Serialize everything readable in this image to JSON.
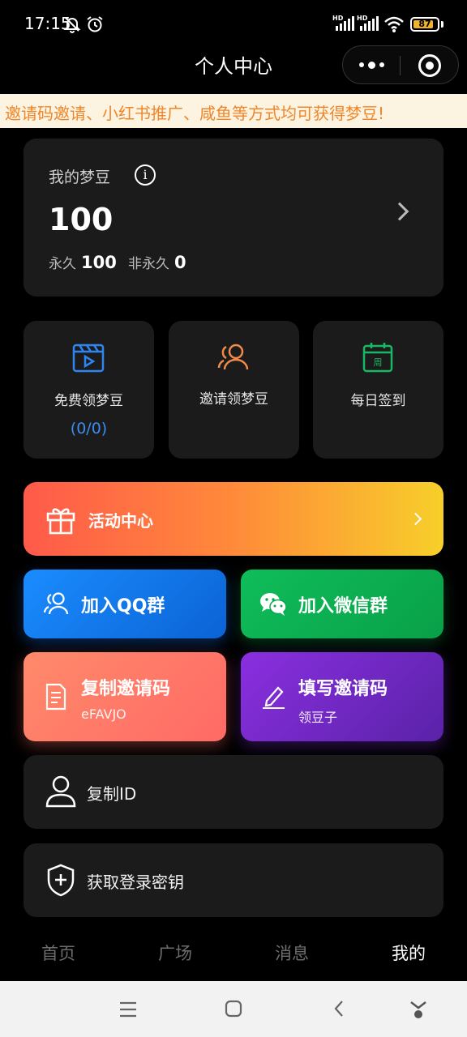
{
  "status_bar": {
    "time": "17:15",
    "hd_label": "HD",
    "battery": "87",
    "battery_level": 0.87,
    "icons": [
      "mute-bell-icon",
      "alarm-icon",
      "signal-icon",
      "signal-icon",
      "wifi-icon",
      "battery-icon"
    ]
  },
  "nav": {
    "title": "个人中心",
    "icons": [
      "more-icon",
      "close-target-icon"
    ]
  },
  "notice": {
    "text": "邀请码邀请、小红书推广、咸鱼等方式均可获得梦豆!"
  },
  "beans": {
    "label": "我的梦豆",
    "total": "100",
    "permanent_label": "永久",
    "permanent_value": "100",
    "temporary_label": "非永久",
    "temporary_value": "0"
  },
  "tiles": [
    {
      "label": "免费领梦豆",
      "count": "(0/0)",
      "icon": "video-icon",
      "color": "#2f86f0"
    },
    {
      "label": "邀请领梦豆",
      "icon": "users-icon",
      "color": "#f08a4b"
    },
    {
      "label": "每日签到",
      "icon": "calendar-icon",
      "color": "#19b862",
      "icon_text": "周"
    }
  ],
  "activity": {
    "label": "活动中心",
    "icon": "gift-icon"
  },
  "actions": {
    "qq": {
      "label": "加入QQ群",
      "icon": "users-icon"
    },
    "wechat": {
      "label": "加入微信群",
      "icon": "wechat-icon"
    },
    "copy_invite": {
      "label": "复制邀请码",
      "sub": "eFAVJO",
      "icon": "document-icon"
    },
    "fill_invite": {
      "label": "填写邀请码",
      "sub": "领豆子",
      "icon": "pencil-icon"
    }
  },
  "rows": [
    {
      "label": "复制ID",
      "icon": "user-icon"
    },
    {
      "label": "获取登录密钥",
      "icon": "shield-plus-icon"
    }
  ],
  "tabs": [
    {
      "label": "首页",
      "active": false
    },
    {
      "label": "广场",
      "active": false
    },
    {
      "label": "消息",
      "active": false
    },
    {
      "label": "我的",
      "active": true
    }
  ],
  "system_nav": {
    "icons": [
      "menu-icon",
      "home-square-icon",
      "back-icon",
      "assistant-icon"
    ]
  }
}
